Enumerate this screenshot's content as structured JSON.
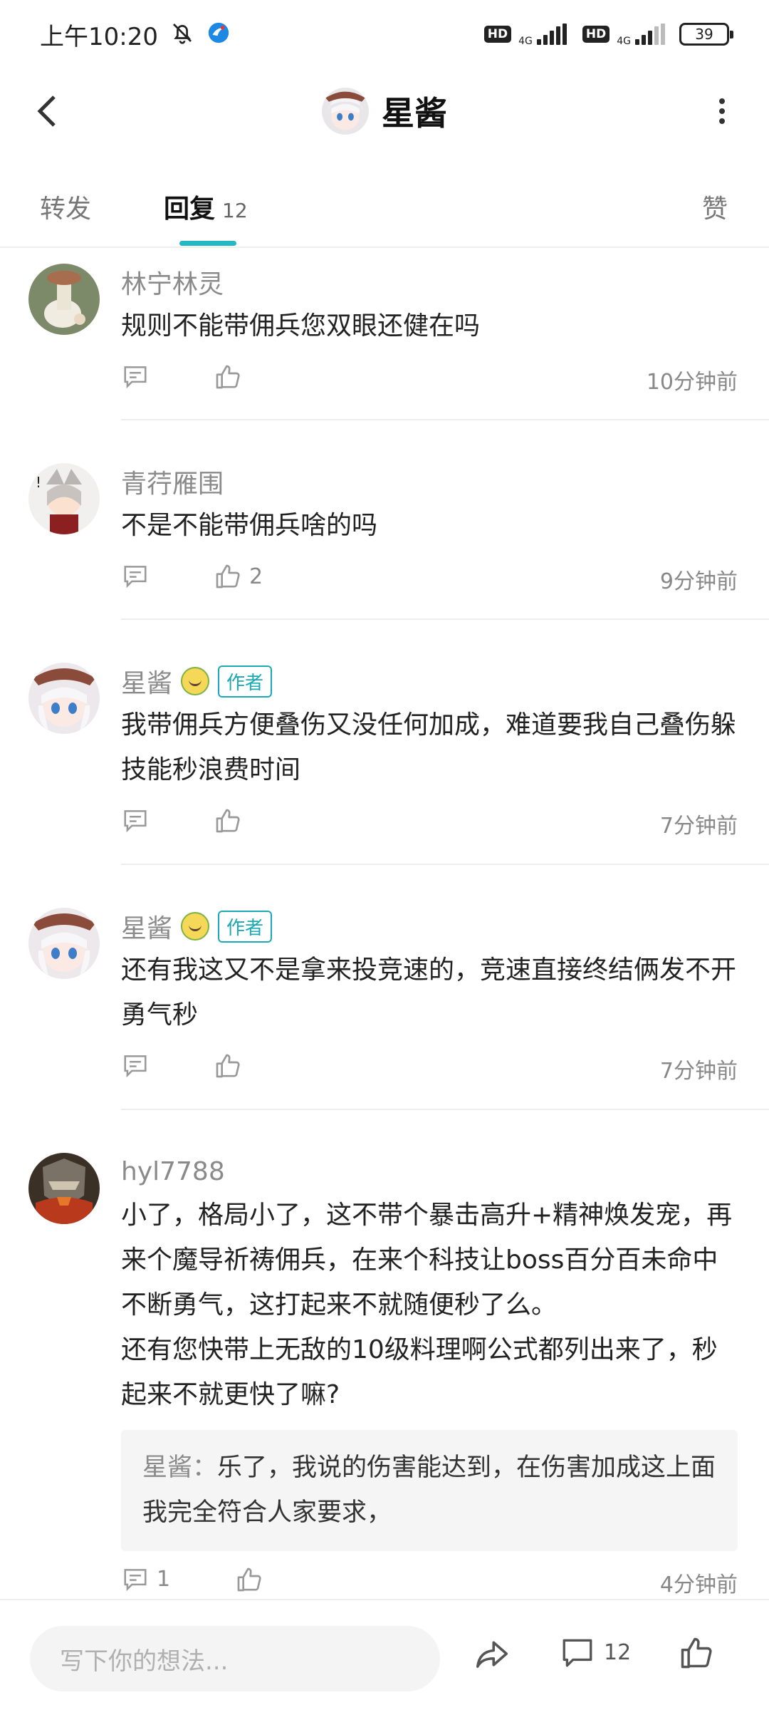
{
  "status": {
    "time": "上午10:20",
    "network_1": "4G",
    "network_2": "4G",
    "hd_1": "HD",
    "hd_2": "HD",
    "battery": "39"
  },
  "header": {
    "title": "星酱"
  },
  "tabs": [
    {
      "label": "转发"
    },
    {
      "label": "回复",
      "count": "12",
      "active": true
    },
    {
      "label": "赞"
    }
  ],
  "comments": [
    {
      "author": "林宁林灵",
      "text": "规则不能带佣兵您双眼还健在吗",
      "likes": "",
      "time": "10分钟前"
    },
    {
      "author": "青荇雁围",
      "text": "不是不能带佣兵啥的吗",
      "likes": "2",
      "time": "9分钟前"
    },
    {
      "author": "星酱",
      "badge": "作者",
      "text": "我带佣兵方便叠伤又没任何加成，难道要我自己叠伤躲技能秒浪费时间",
      "likes": "",
      "time": "7分钟前"
    },
    {
      "author": "星酱",
      "badge": "作者",
      "text": "还有我这又不是拿来投竞速的，竞速直接终结俩发不开勇气秒",
      "likes": "",
      "time": "7分钟前"
    },
    {
      "author": "hyl7788",
      "text": "小了，格局小了，这不带个暴击高升+精神焕发宠，再来个魔导祈祷佣兵，在来个科技让boss百分百未命中不断勇气，这打起来不就随便秒了么。\n还有您快带上无敌的10级料理啊公式都列出来了，秒起来不就更快了嘛?",
      "reply_author": "星酱",
      "reply_sep": "：",
      "reply_text": "乐了，我说的伤害能达到，在伤害加成这上面我完全符合人家要求，",
      "reply_count": "1",
      "time": "4分钟前"
    }
  ],
  "bottom_bar": {
    "input_placeholder": "写下你的想法...",
    "comment_count": "12"
  },
  "colors": {
    "accent": "#22b8c4",
    "author_badge": "#1ba9b5"
  }
}
